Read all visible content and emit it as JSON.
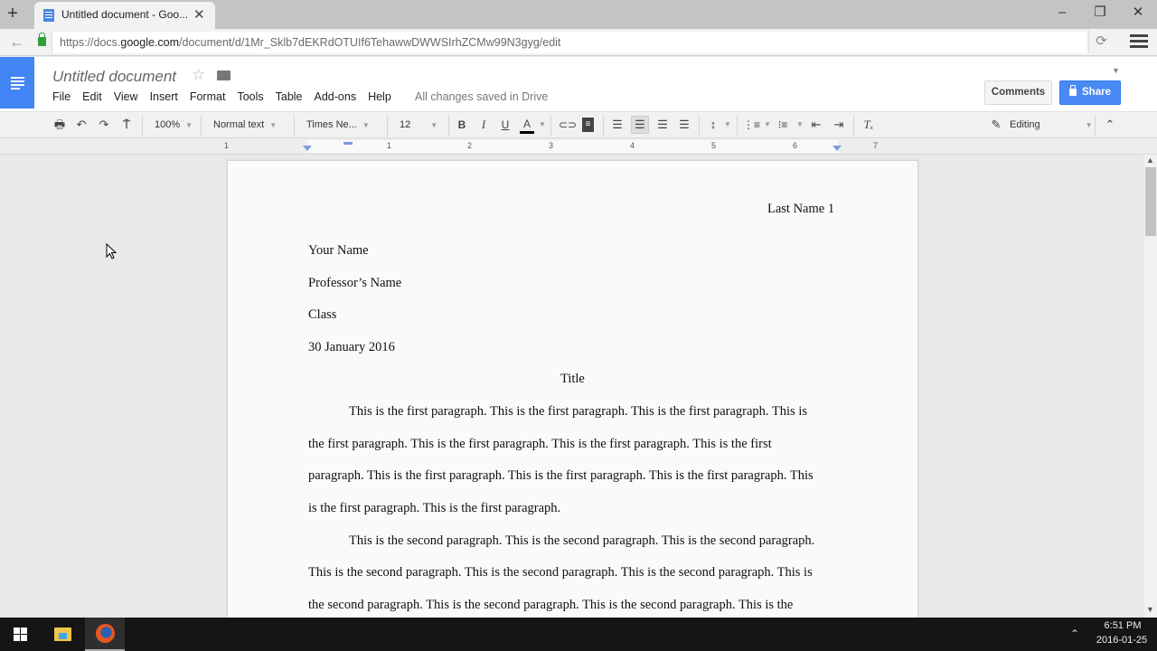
{
  "browser": {
    "tab_title": "Untitled document - Goo...",
    "url_prefix": "https://docs.",
    "url_domain": "google.com",
    "url_path": "/document/d/1Mr_Sklb7dEKRdOTUIf6TehawwDWWSIrhZCMw99N3gyg/edit"
  },
  "docs": {
    "title": "Untitled document",
    "menu": [
      "File",
      "Edit",
      "View",
      "Insert",
      "Format",
      "Tools",
      "Table",
      "Add-ons",
      "Help"
    ],
    "save_status": "All changes saved in Drive",
    "comments_label": "Comments",
    "share_label": "Share"
  },
  "toolbar": {
    "zoom": "100%",
    "style": "Normal text",
    "font": "Times Ne...",
    "size": "12",
    "bold": "B",
    "italic": "I",
    "underline": "U",
    "text_color": "A",
    "mode": "Editing"
  },
  "ruler": {
    "numbers": [
      "1",
      "1",
      "2",
      "3",
      "4",
      "5",
      "6",
      "7"
    ]
  },
  "document": {
    "header": "Last Name 1",
    "lines": [
      "Your Name",
      "Professor’s Name",
      "Class",
      "30 January 2016"
    ],
    "title": "Title",
    "paragraph1": [
      "This is the first paragraph. This is the first paragraph. This is the first paragraph. This is",
      "the first paragraph. This is the first paragraph. This is the first paragraph. This is the first",
      "paragraph. This is the first paragraph. This is the first paragraph. This is the first paragraph. This",
      "is the first paragraph. This is the first paragraph."
    ],
    "paragraph2": [
      "This is the second paragraph. This is the second paragraph. This is the second paragraph.",
      "This is the second paragraph. This is the second paragraph. This is the second paragraph. This is",
      "the second paragraph. This is the second paragraph. This is the second paragraph. This is the"
    ]
  },
  "taskbar": {
    "time": "6:51 PM",
    "date": "2016-01-25"
  },
  "colors": {
    "docs_blue": "#4285f4",
    "share_blue": "#4a8af4"
  }
}
